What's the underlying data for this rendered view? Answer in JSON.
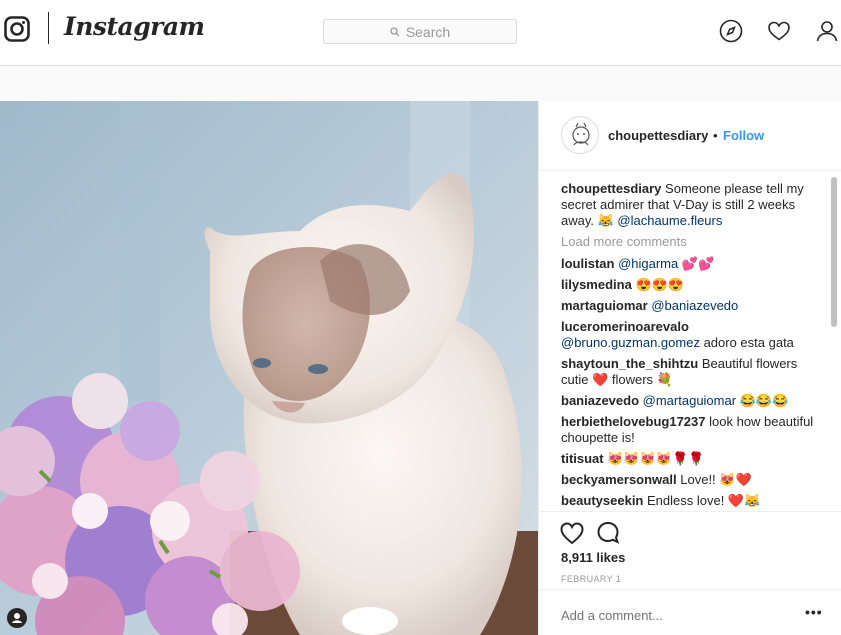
{
  "header": {
    "wordmark": "Instagram",
    "search_placeholder": "Search"
  },
  "post": {
    "author": "choupettesdiary",
    "separator": "•",
    "follow_label": "Follow",
    "caption": {
      "user": "choupettesdiary",
      "text": "Someone please tell my secret admirer that V-Day is still 2 weeks away. 😹 ",
      "mention": "@lachaume.fleurs"
    },
    "load_more": "Load more comments",
    "comments": [
      {
        "user": "loulistan",
        "mention": "@higarma",
        "text": "💕💕"
      },
      {
        "user": "lilysmedina",
        "mention": "",
        "text": "😍😍😍"
      },
      {
        "user": "martaguiomar",
        "mention": "@baniazevedo",
        "text": ""
      },
      {
        "user": "luceromerinoarevalo",
        "mention": "@bruno.guzman.gomez",
        "text": "adoro esta gata"
      },
      {
        "user": "shaytoun_the_shihtzu",
        "mention": "",
        "text": "Beautiful flowers cutie ❤️ flowers 💐"
      },
      {
        "user": "baniazevedo",
        "mention": "@martaguiomar",
        "text": "😂😂😂"
      },
      {
        "user": "herbiethelovebug17237",
        "mention": "",
        "text": "look how beautiful choupette is!"
      },
      {
        "user": "titisuat",
        "mention": "",
        "text": "😻😻😻😻🌹🌹"
      },
      {
        "user": "beckyamersonwall",
        "mention": "",
        "text": "Love!! 😻❤️"
      },
      {
        "user": "beautyseekin",
        "mention": "",
        "text": "Endless love! ❤️😹"
      }
    ],
    "likes": "8,911 likes",
    "date": "FEBRUARY 1",
    "add_comment_placeholder": "Add a comment...",
    "more_options": "•••"
  },
  "icons": {
    "logo": "instagram-camera-icon",
    "search": "search-icon",
    "explore": "compass-icon",
    "activity": "heart-icon",
    "profile": "person-icon",
    "like": "heart-outline-icon",
    "comment": "speech-bubble-icon",
    "user_tag": "person-tag-icon"
  },
  "colors": {
    "link": "#3897f0",
    "mention": "#003569",
    "muted": "#999999"
  }
}
